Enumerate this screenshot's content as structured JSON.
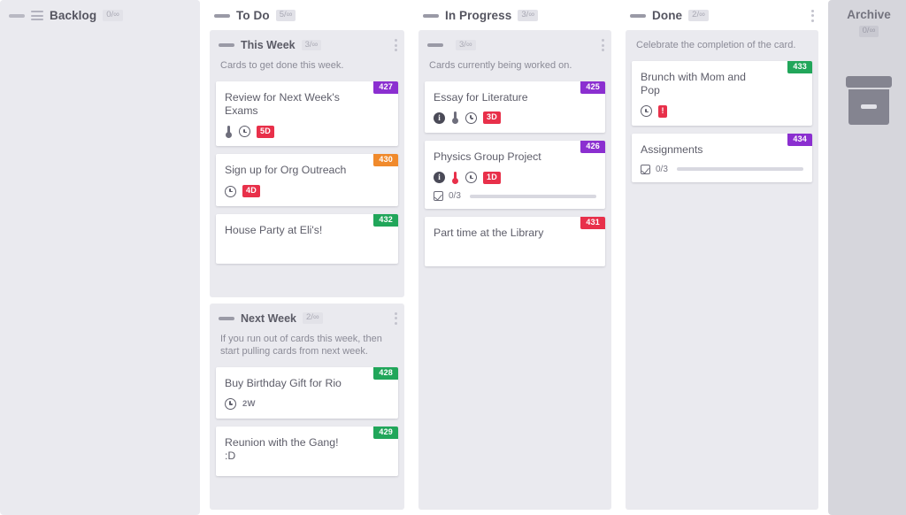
{
  "colors": {
    "board_bg": "#ffffff",
    "column_bg": "#eaeaef",
    "archive_bg": "#d6d6dc",
    "card_bg": "#ffffff",
    "purple": "#8b2fd0",
    "orange": "#f08a2c",
    "green": "#21a65a",
    "red": "#e8304a",
    "title_text": "#555560",
    "body_text": "#5d5d69",
    "muted_text": "#8b8b97"
  },
  "columns": [
    {
      "name": "backlog",
      "title": "Backlog",
      "wip": "0/∞",
      "has_list_icon": true,
      "lanes": []
    },
    {
      "name": "todo",
      "title": "To Do",
      "wip": "5/∞",
      "has_list_icon": false,
      "lanes": [
        {
          "title": "This Week",
          "wip": "3/∞",
          "description": "Cards to get done this week.",
          "cards": [
            {
              "title": "Review for Next Week's Exams",
              "id": "427",
              "id_color": "#8b2fd0",
              "icons": [
                "thermometer",
                "clock"
              ],
              "priority": "normal",
              "due": "5D",
              "checklist": null
            },
            {
              "title": "Sign up for Org Outreach",
              "id": "430",
              "id_color": "#f08a2c",
              "icons": [
                "clock"
              ],
              "priority": "none",
              "due": "4D",
              "checklist": null
            },
            {
              "title": "House Party at Eli's!",
              "id": "432",
              "id_color": "#21a65a",
              "icons": [],
              "priority": "none",
              "due": null,
              "checklist": null
            }
          ]
        },
        {
          "title": "Next Week",
          "wip": "2/∞",
          "description": "If you run out of cards this week, then start pulling cards from next week.",
          "cards": [
            {
              "title": "Buy Birthday Gift for Rio",
              "id": "428",
              "id_color": "#21a65a",
              "icons": [
                "clock"
              ],
              "priority": "none",
              "due_text": "2W",
              "due": null,
              "checklist": null
            },
            {
              "title": "Reunion with the Gang! :D",
              "id": "429",
              "id_color": "#21a65a",
              "icons": [],
              "priority": "none",
              "due": null,
              "checklist": null
            }
          ]
        }
      ]
    },
    {
      "name": "in-progress",
      "title": "In Progress",
      "wip": "3/∞",
      "has_list_icon": false,
      "lanes": [
        {
          "title": "",
          "wip": "3/∞",
          "description": "Cards currently being worked on.",
          "cards": [
            {
              "title": "Essay for Literature",
              "id": "425",
              "id_color": "#8b2fd0",
              "icons": [
                "info",
                "thermometer",
                "clock"
              ],
              "priority": "normal",
              "due": "3D",
              "checklist": null
            },
            {
              "title": "Physics Group Project",
              "id": "426",
              "id_color": "#8b2fd0",
              "icons": [
                "info",
                "thermometer",
                "clock"
              ],
              "priority": "high",
              "due": "1D",
              "checklist": "0/3"
            },
            {
              "title": "Part time at the Library",
              "id": "431",
              "id_color": "#e8304a",
              "icons": [],
              "priority": "none",
              "due": null,
              "checklist": null
            }
          ]
        }
      ]
    },
    {
      "name": "done",
      "title": "Done",
      "wip": "2/∞",
      "has_list_icon": false,
      "lanes": [
        {
          "title": "",
          "wip": "",
          "description": "Celebrate the completion of the card.",
          "no_head": true,
          "cards": [
            {
              "title": "Brunch with Mom and Pop",
              "id": "433",
              "id_color": "#21a65a",
              "icons": [
                "clock"
              ],
              "priority": "none",
              "due": "!",
              "checklist": null
            },
            {
              "title": "Assignments",
              "id": "434",
              "id_color": "#8b2fd0",
              "icons": [],
              "priority": "none",
              "due": null,
              "checklist": "0/3"
            }
          ]
        }
      ]
    }
  ],
  "archive": {
    "title": "Archive",
    "wip": "0/∞",
    "icon": "archive-box-icon"
  }
}
